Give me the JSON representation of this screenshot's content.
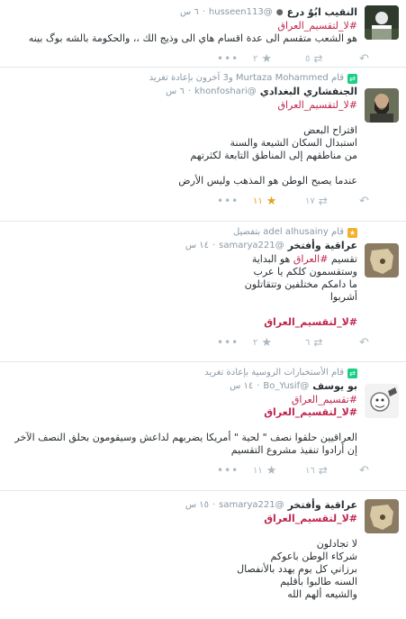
{
  "tweets": [
    {
      "context": "",
      "name": "النقيب ابُوٌ درع",
      "handle": "@husseen113",
      "time": "٦ س",
      "lines": [
        {
          "type": "hashtag",
          "text": "#لا_لتقسيم_العراق"
        },
        {
          "type": "text",
          "text": "هو الشعب متقسم الى عدة اقسام هاي الى وذيج الك ،، والحكومة بالشه بوگ بينه"
        }
      ],
      "retweets": "٥",
      "favorites": "٢",
      "fav_active": false
    },
    {
      "context": "قام Murtaza Mohammed و3 آخرون بإعادة تغريد",
      "name": "الجنفشاري البغدادي",
      "handle": "@khonfoshari",
      "time": "٦ س",
      "lines": [
        {
          "type": "hashtag",
          "text": "#لا_لتقسيم_العراق"
        },
        {
          "type": "blank",
          "text": ""
        },
        {
          "type": "text",
          "text": "اقتراح البعض"
        },
        {
          "type": "text",
          "text": "استبدال السكان الشيعة والسنة"
        },
        {
          "type": "text",
          "text": "من مناطقهم إلى المناطق التابعة لكثرتهم"
        },
        {
          "type": "blank",
          "text": ""
        },
        {
          "type": "text",
          "text": "عندما يصبح الوطن هو المذهب وليس الأرض"
        }
      ],
      "retweets": "١٧",
      "favorites": "١١",
      "fav_active": true
    },
    {
      "context": "قام adel alhusainy بتفضيل",
      "name": "عراقية وأفتخر",
      "handle": "@samarya221",
      "time": "١٤ س",
      "lines": [
        {
          "type": "mixed",
          "before": "تقسيم ",
          "hashtag": "#العراق",
          "after": " هو البداية"
        },
        {
          "type": "text",
          "text": "وستقسمون كلكم يا عرب"
        },
        {
          "type": "text",
          "text": "ما دامكم مختلفين وتتقاتلون"
        },
        {
          "type": "text",
          "text": "أشربوا"
        },
        {
          "type": "blank",
          "text": ""
        },
        {
          "type": "hashtag",
          "text": "#لا_لتقسيم_العراق"
        }
      ],
      "retweets": "٦",
      "favorites": "٢",
      "fav_active": false
    },
    {
      "context": "قام الأستخبارات الروسية بإعادة تغريد",
      "name": "بو يوسف",
      "handle": "@Bo_Yusif",
      "time": "١٤ س",
      "lines": [
        {
          "type": "hashtag",
          "text": "#تقسيم_العراق"
        },
        {
          "type": "hashtag",
          "text": "#لا_لتقسيم_العراق"
        },
        {
          "type": "blank",
          "text": ""
        },
        {
          "type": "text",
          "text": "العراقيين حلقوا نصف \" لحية \" أمريكا يضربهم لداعش وسيقومون بحلق النصف الآخر إن أرادوا تنفيذ مشروع التقسيم"
        }
      ],
      "retweets": "١٦",
      "favorites": "١١",
      "fav_active": false
    },
    {
      "context": "",
      "name": "عراقية وأفتخر",
      "handle": "@samarya221",
      "time": "١٥ س",
      "lines": [
        {
          "type": "hashtag",
          "text": "#لا_لتقسيم_العراق"
        },
        {
          "type": "blank",
          "text": ""
        },
        {
          "type": "text",
          "text": "لا تجادلون"
        },
        {
          "type": "text",
          "text": "شركاء الوطن باعوكم"
        },
        {
          "type": "text",
          "text": "برزاني كل يوم يهدد بالأنفصال"
        },
        {
          "type": "text",
          "text": "السنه طالبوا بأقليم"
        },
        {
          "type": "text",
          "text": "والشيعه ألهم الله"
        }
      ],
      "retweets": "",
      "favorites": "",
      "fav_active": false
    }
  ],
  "colors": {
    "hashtag": "#c0254e",
    "favorite_active": "#e2a41a",
    "muted": "#8899a6"
  },
  "icons": {
    "reply": "reply-icon",
    "retweet": "retweet-icon",
    "favorite": "star-icon",
    "more": "more-icon"
  }
}
